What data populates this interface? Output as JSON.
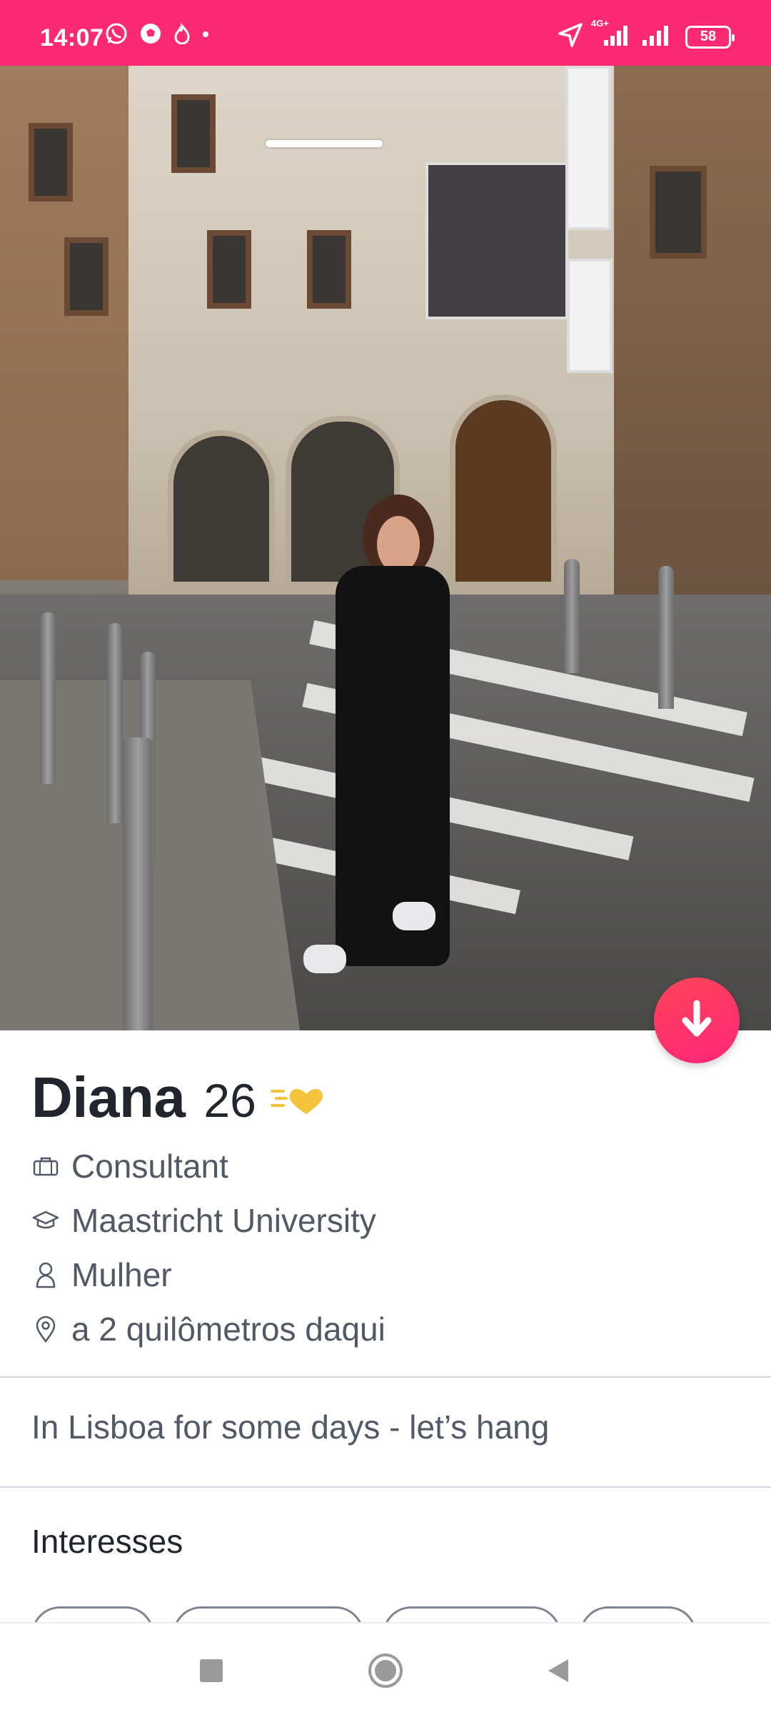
{
  "status_bar": {
    "time": "14:07",
    "network_label": "4G+",
    "battery": "58"
  },
  "profile": {
    "name": "Diana",
    "age": "26",
    "job": "Consultant",
    "school": "Maastricht University",
    "gender": "Mulher",
    "distance": "a 2 quilômetros daqui",
    "bio": "In Lisboa for some days - let’s hang"
  },
  "sections": {
    "interests_title": "Interesses"
  },
  "colors": {
    "brand": "#fd2a73",
    "accent_gradient_start": "#ff4458",
    "accent_gradient_end": "#fd267a",
    "text_primary": "#21262e",
    "text_secondary": "#505965",
    "badge_gold": "#f5c33b"
  },
  "icons": {
    "job": "briefcase-icon",
    "school": "graduation-cap-icon",
    "gender": "person-icon",
    "distance": "location-pin-icon",
    "down": "arrow-down-icon"
  }
}
